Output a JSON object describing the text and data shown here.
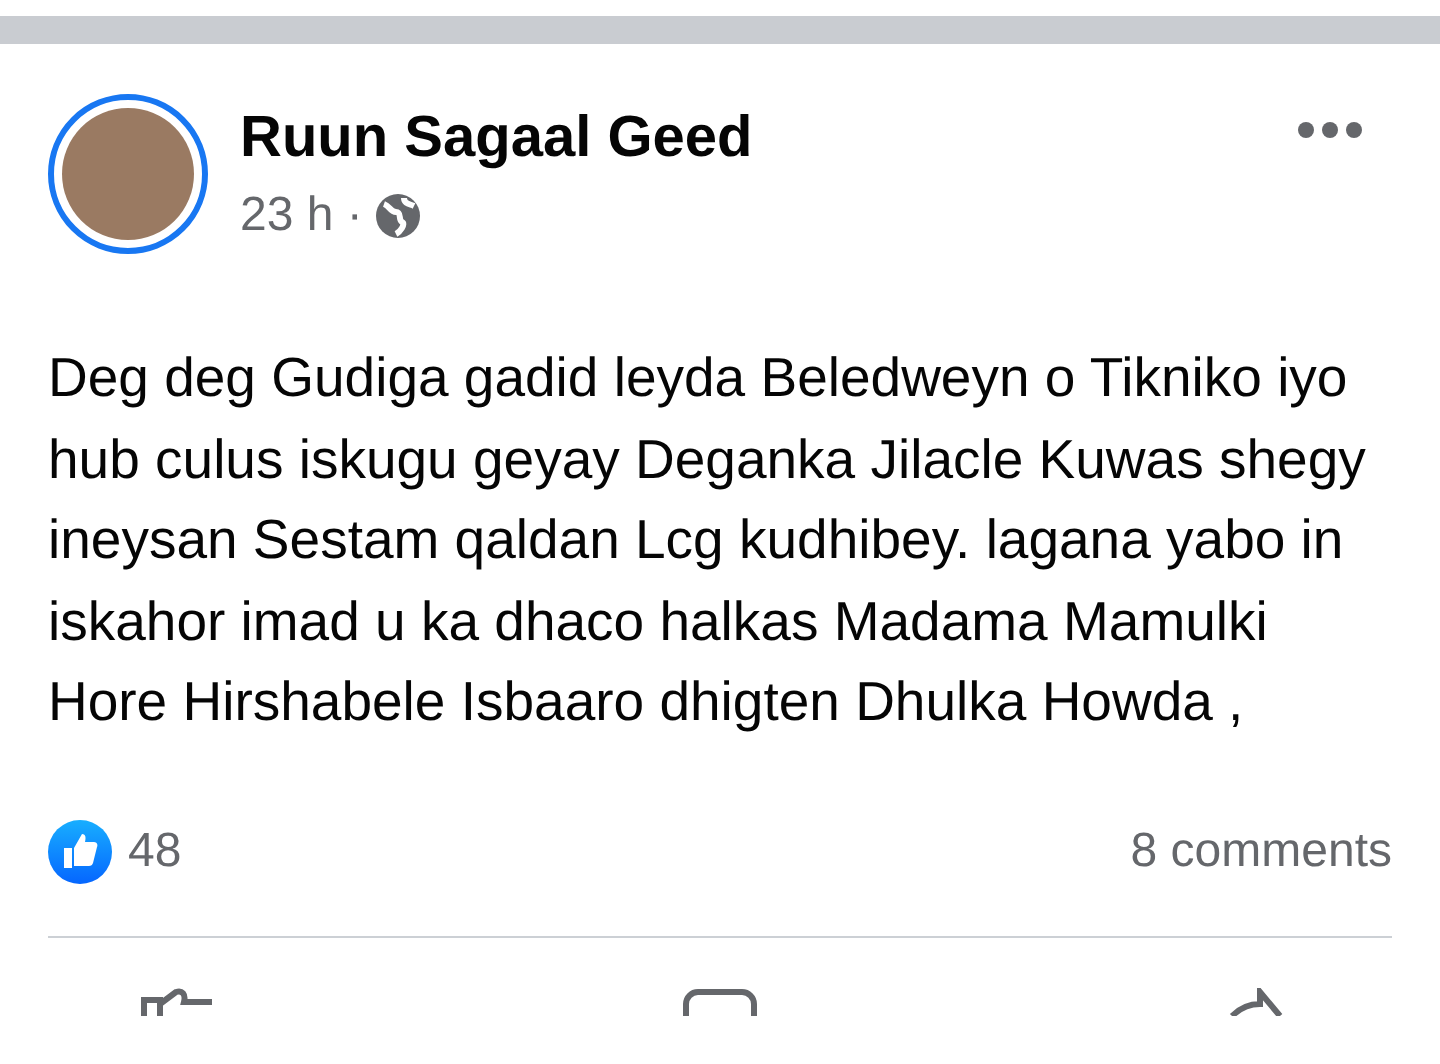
{
  "post": {
    "author": "Ruun Sagaal Geed",
    "time": "23 h ·",
    "text": "Deg deg Gudiga gadid leyda Beledweyn o Tikniko iyo hub culus iskugu geyay Deganka Jilacle Kuwas shegy ineysan Sestam qaldan Lcg kudhibey. lagana yabo in iskahor imad u ka dhaco halkas Madama Mamulki Hore Hirshabele Isbaaro dhigten Dhulka Howda ,",
    "reactions": "48",
    "comments": "8 comments"
  }
}
